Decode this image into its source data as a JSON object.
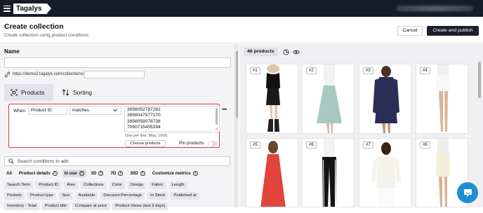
{
  "app": {
    "logo_text": "Tagalys"
  },
  "header": {
    "title": "Create collection",
    "subtitle": "Create collection using product conditions",
    "cancel_label": "Cancel",
    "publish_label": "Create and publish"
  },
  "form": {
    "name_label": "Name",
    "name_value": "",
    "url_prefix": "https://demo2.tagalys.com/collections/",
    "url_value": ""
  },
  "tabs": [
    {
      "label": "Products",
      "icon": "products-scan-icon",
      "active": true
    },
    {
      "label": "Sorting",
      "icon": "sort-arrows-icon",
      "active": false
    }
  ],
  "condition": {
    "when_label": "When",
    "field": "Product ID",
    "operator": "matches",
    "values": [
      "3956052787282",
      "3956047577170",
      "3956059078738",
      "7060715405394"
    ],
    "hint": "One per line. Max: 1000.",
    "choose_label": "Choose products",
    "pin_label": "Pin products",
    "pin_enabled": false
  },
  "condition_search": {
    "placeholder": "Search conditions to add"
  },
  "filters": [
    {
      "label": "All",
      "info": false,
      "active": false
    },
    {
      "label": "Product details",
      "info": true,
      "active": false
    },
    {
      "label": "In use",
      "info": true,
      "active": true
    },
    {
      "label": "3D",
      "info": true,
      "active": false
    },
    {
      "label": "7D",
      "info": true,
      "active": false
    },
    {
      "label": "30D",
      "info": true,
      "active": false
    },
    {
      "label": "Customize metrics",
      "info": true,
      "active": false
    }
  ],
  "chips": [
    [
      "Search Term",
      "Product ID",
      "Alan",
      "Collections",
      "Color",
      "Design",
      "Fabric",
      "Length"
    ],
    [
      "Pockets",
      "Product type",
      "Size",
      "Available",
      "Discount Percentage",
      "In Stock",
      "Published at"
    ],
    [
      "Inventory - Total",
      "Product title",
      "Compare at price",
      "Product Views (last 3 days)"
    ]
  ],
  "results": {
    "count_label": "48 products",
    "icons": [
      "pie-chart-icon",
      "eye-icon"
    ]
  },
  "products": [
    {
      "num": "#1",
      "item": "black-leather-skirt"
    },
    {
      "num": "#2",
      "item": "mint-pleated-skirt"
    },
    {
      "num": "#3",
      "item": "navy-shirt-dress"
    },
    {
      "num": "#4",
      "item": "white-mini-skirt"
    },
    {
      "num": "#5",
      "item": "red-maxi-dress"
    },
    {
      "num": "#6",
      "item": "black-track-pants"
    },
    {
      "num": "#7",
      "item": "white-sweater"
    },
    {
      "num": "#8",
      "item": "cream-pencil-skirt"
    }
  ],
  "colors": {
    "topbar": "#181b2a",
    "primary_button": "#1b1e2c",
    "highlight_border": "#e0303a",
    "chat_bubble": "#1f8fd4"
  }
}
